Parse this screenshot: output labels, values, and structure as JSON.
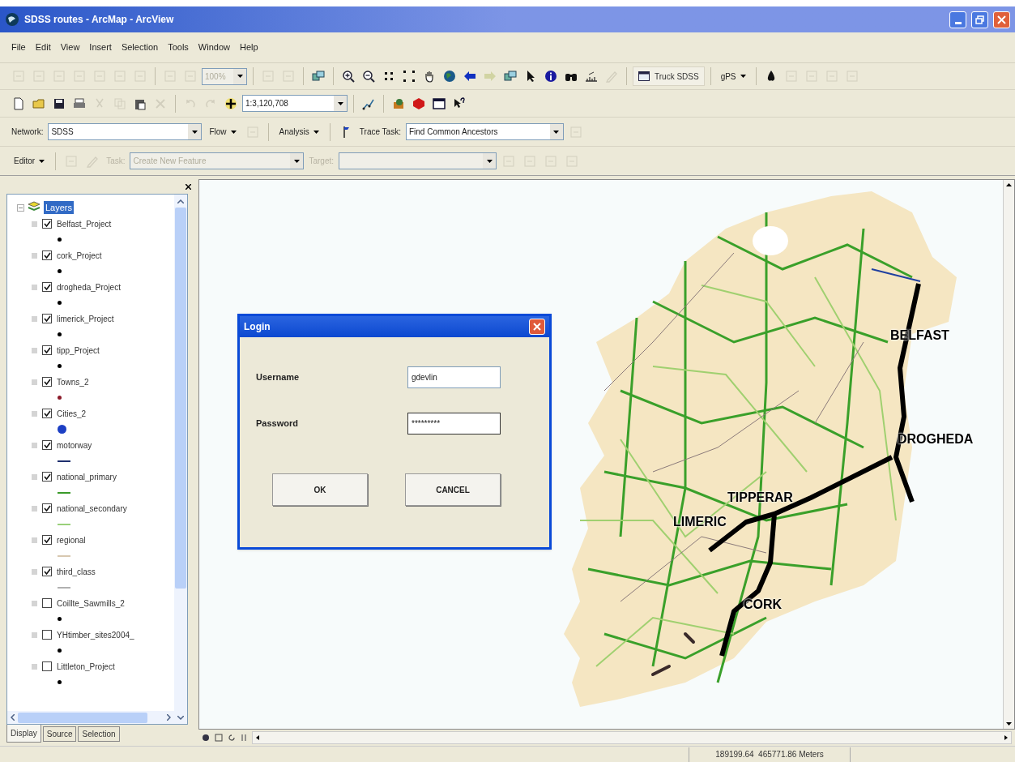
{
  "window": {
    "title": "SDSS routes - ArcMap - ArcView"
  },
  "menu": [
    "File",
    "Edit",
    "View",
    "Insert",
    "Selection",
    "Tools",
    "Window",
    "Help"
  ],
  "toolbars": [
    [
      {
        "kind": "icon",
        "disabled": true
      },
      {
        "kind": "icon",
        "disabled": true
      },
      {
        "kind": "icon",
        "disabled": true
      },
      {
        "kind": "icon",
        "disabled": true
      },
      {
        "kind": "icon",
        "disabled": true
      },
      {
        "kind": "icon",
        "disabled": true
      },
      {
        "kind": "icon",
        "disabled": true
      },
      {
        "kind": "sep"
      },
      {
        "kind": "icon",
        "disabled": true
      },
      {
        "kind": "icon",
        "disabled": true
      },
      {
        "kind": "combo",
        "value": "100%",
        "disabled": true
      },
      {
        "kind": "sep"
      },
      {
        "kind": "icon",
        "disabled": true
      },
      {
        "kind": "icon",
        "disabled": true
      },
      {
        "kind": "sep"
      },
      {
        "kind": "icon",
        "disabled": false
      },
      {
        "kind": "sep"
      },
      {
        "kind": "icon",
        "disabled": false
      },
      {
        "kind": "icon",
        "disabled": false
      },
      {
        "kind": "icon",
        "disabled": false
      },
      {
        "kind": "icon",
        "disabled": false
      },
      {
        "kind": "icon",
        "disabled": false
      },
      {
        "kind": "icon",
        "disabled": false
      },
      {
        "kind": "icon",
        "disabled": false
      },
      {
        "kind": "icon",
        "disabled": true
      },
      {
        "kind": "icon",
        "disabled": false
      },
      {
        "kind": "icon",
        "disabled": false
      },
      {
        "kind": "icon",
        "disabled": false
      },
      {
        "kind": "icon",
        "disabled": false
      },
      {
        "kind": "icon",
        "disabled": false
      },
      {
        "kind": "icon",
        "disabled": true
      },
      {
        "kind": "sep"
      },
      {
        "kind": "text-button",
        "label": "Truck SDSS"
      },
      {
        "kind": "sep"
      },
      {
        "kind": "menu",
        "label": "gPS"
      },
      {
        "kind": "sep"
      },
      {
        "kind": "icon",
        "disabled": false
      },
      {
        "kind": "icon",
        "disabled": true
      },
      {
        "kind": "icon",
        "disabled": true
      },
      {
        "kind": "icon",
        "disabled": true
      },
      {
        "kind": "icon",
        "disabled": true
      }
    ],
    [
      {
        "kind": "icon",
        "disabled": false
      },
      {
        "kind": "icon",
        "disabled": false
      },
      {
        "kind": "icon",
        "disabled": false
      },
      {
        "kind": "icon",
        "disabled": false
      },
      {
        "kind": "icon",
        "disabled": true
      },
      {
        "kind": "icon",
        "disabled": true
      },
      {
        "kind": "icon",
        "disabled": false
      },
      {
        "kind": "icon",
        "disabled": true
      },
      {
        "kind": "sep"
      },
      {
        "kind": "icon",
        "disabled": true
      },
      {
        "kind": "icon",
        "disabled": true
      },
      {
        "kind": "icon",
        "disabled": false
      },
      {
        "kind": "combo",
        "value": "1:3,120,708",
        "disabled": false
      },
      {
        "kind": "sep"
      },
      {
        "kind": "icon",
        "disabled": false
      },
      {
        "kind": "sep"
      },
      {
        "kind": "icon",
        "disabled": false
      },
      {
        "kind": "icon",
        "disabled": false
      },
      {
        "kind": "icon",
        "disabled": false
      },
      {
        "kind": "icon",
        "disabled": false
      }
    ],
    [
      {
        "kind": "label",
        "text": "Network:",
        "disabled": false
      },
      {
        "kind": "combo",
        "value": "SDSS",
        "disabled": false
      },
      {
        "kind": "menu",
        "label": "Flow"
      },
      {
        "kind": "icon",
        "disabled": true
      },
      {
        "kind": "sep"
      },
      {
        "kind": "menu",
        "label": "Analysis"
      },
      {
        "kind": "sep"
      },
      {
        "kind": "icon",
        "disabled": false
      },
      {
        "kind": "label",
        "text": "Trace Task:",
        "disabled": false
      },
      {
        "kind": "combo",
        "value": "Find Common Ancestors",
        "disabled": false
      },
      {
        "kind": "icon",
        "disabled": true
      }
    ],
    [
      {
        "kind": "menu",
        "label": "Editor"
      },
      {
        "kind": "sep"
      },
      {
        "kind": "icon",
        "disabled": true
      },
      {
        "kind": "icon",
        "disabled": true
      },
      {
        "kind": "label",
        "text": "Task:",
        "disabled": true
      },
      {
        "kind": "combo",
        "value": "Create New Feature",
        "disabled": true
      },
      {
        "kind": "label",
        "text": "Target:",
        "disabled": true
      },
      {
        "kind": "combo",
        "disabled": true
      },
      {
        "kind": "icon",
        "disabled": true
      },
      {
        "kind": "icon",
        "disabled": true
      },
      {
        "kind": "icon",
        "disabled": true
      },
      {
        "kind": "icon",
        "disabled": true
      }
    ]
  ],
  "toc": {
    "root": {
      "label": "Layers",
      "selected": true
    },
    "layers": [
      {
        "name": "Belfast_Project",
        "checked": true,
        "kind": "point",
        "color": "#000000"
      },
      {
        "name": "cork_Project",
        "checked": true,
        "kind": "point",
        "color": "#000000"
      },
      {
        "name": "drogheda_Project",
        "checked": true,
        "kind": "point",
        "color": "#000000"
      },
      {
        "name": "limerick_Project",
        "checked": true,
        "kind": "point",
        "color": "#000000"
      },
      {
        "name": "tipp_Project",
        "checked": true,
        "kind": "point",
        "color": "#000000"
      },
      {
        "name": "Towns_2",
        "checked": true,
        "kind": "point",
        "color": "#8b1a2a"
      },
      {
        "name": "Cities_2",
        "checked": true,
        "kind": "circle",
        "color": "#1c3fc4"
      },
      {
        "name": "motorway",
        "checked": true,
        "kind": "line",
        "color": "#1f2f6e"
      },
      {
        "name": "national_primary",
        "checked": true,
        "kind": "line",
        "color": "#3a9a2a"
      },
      {
        "name": "national_secondary",
        "checked": true,
        "kind": "line",
        "color": "#9ad07a"
      },
      {
        "name": "regional",
        "checked": true,
        "kind": "line",
        "color": "#d8c8b0"
      },
      {
        "name": "third_class",
        "checked": true,
        "kind": "line",
        "color": "#b0b0b0"
      },
      {
        "name": "Coillte_Sawmills_2",
        "checked": false,
        "kind": "point",
        "color": "#000000"
      },
      {
        "name": "YHtimber_sites2004_",
        "checked": false,
        "kind": "point",
        "color": "#000000"
      },
      {
        "name": "Littleton_Project",
        "checked": false,
        "kind": "point",
        "color": "#000000"
      }
    ]
  },
  "toc_tabs": [
    {
      "label": "Display",
      "selected": true
    },
    {
      "label": "Source",
      "selected": false
    },
    {
      "label": "Selection",
      "selected": false
    }
  ],
  "map": {
    "labels": [
      "BELFAST",
      "DROGHEDA",
      "TIPPERAR",
      "LIMERIC",
      "CORK"
    ]
  },
  "login": {
    "title": "Login",
    "fields": [
      {
        "label": "Username",
        "value": "gdevlin"
      },
      {
        "label": "Password",
        "value": "*********"
      }
    ],
    "buttons": [
      "OK",
      "CANCEL"
    ]
  },
  "status_bar": {
    "coordinates": "189199.64  465771.86 Meters"
  }
}
